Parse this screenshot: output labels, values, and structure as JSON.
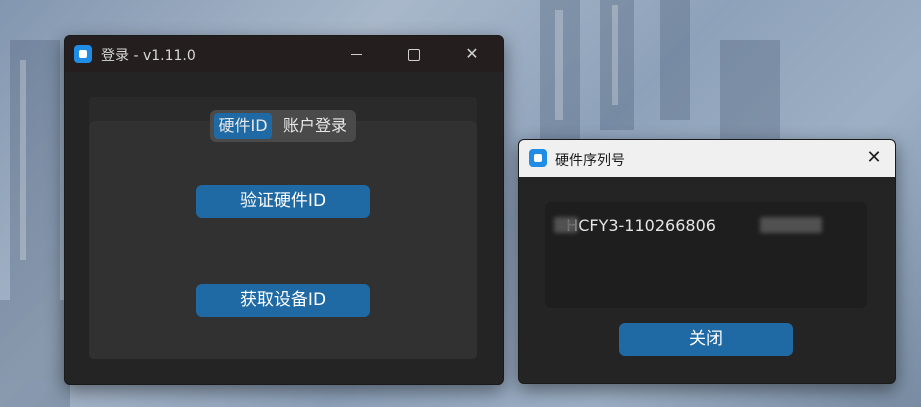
{
  "main_window": {
    "title": "登录 - v1.11.0",
    "controls": {
      "minimize_icon": "minimize-icon",
      "maximize_icon": "maximize-icon",
      "close_icon": "close-icon",
      "close_glyph": "✕"
    },
    "tabs": [
      {
        "label": "硬件ID",
        "selected": true
      },
      {
        "label": "账户登录",
        "selected": false
      }
    ],
    "buttons": {
      "verify": "验证硬件ID",
      "get_device": "获取设备ID"
    }
  },
  "serial_dialog": {
    "title": "硬件序列号",
    "close_glyph": "✕",
    "serial_value": "HCFY3-110266806",
    "close_button": "关闭"
  },
  "colors": {
    "accent": "#1f6aa5",
    "window_bg": "#242424",
    "panel_bg": "#313131",
    "app_icon": "#1f8de6"
  }
}
